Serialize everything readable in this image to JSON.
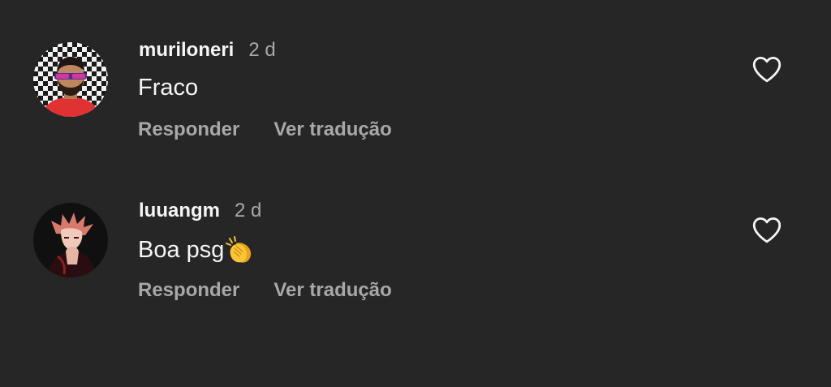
{
  "comments": [
    {
      "username": "muriloneri",
      "time": "2 d",
      "text": "Fraco",
      "reply_label": "Responder",
      "translate_label": "Ver tradução"
    },
    {
      "username": "luuangm",
      "time": "2 d",
      "text": "Boa psg",
      "emoji": "clapping-hands",
      "reply_label": "Responder",
      "translate_label": "Ver tradução"
    }
  ],
  "colors": {
    "background": "#262626",
    "primary_text": "#f5f5f5",
    "secondary_text": "#a8a8a8"
  }
}
